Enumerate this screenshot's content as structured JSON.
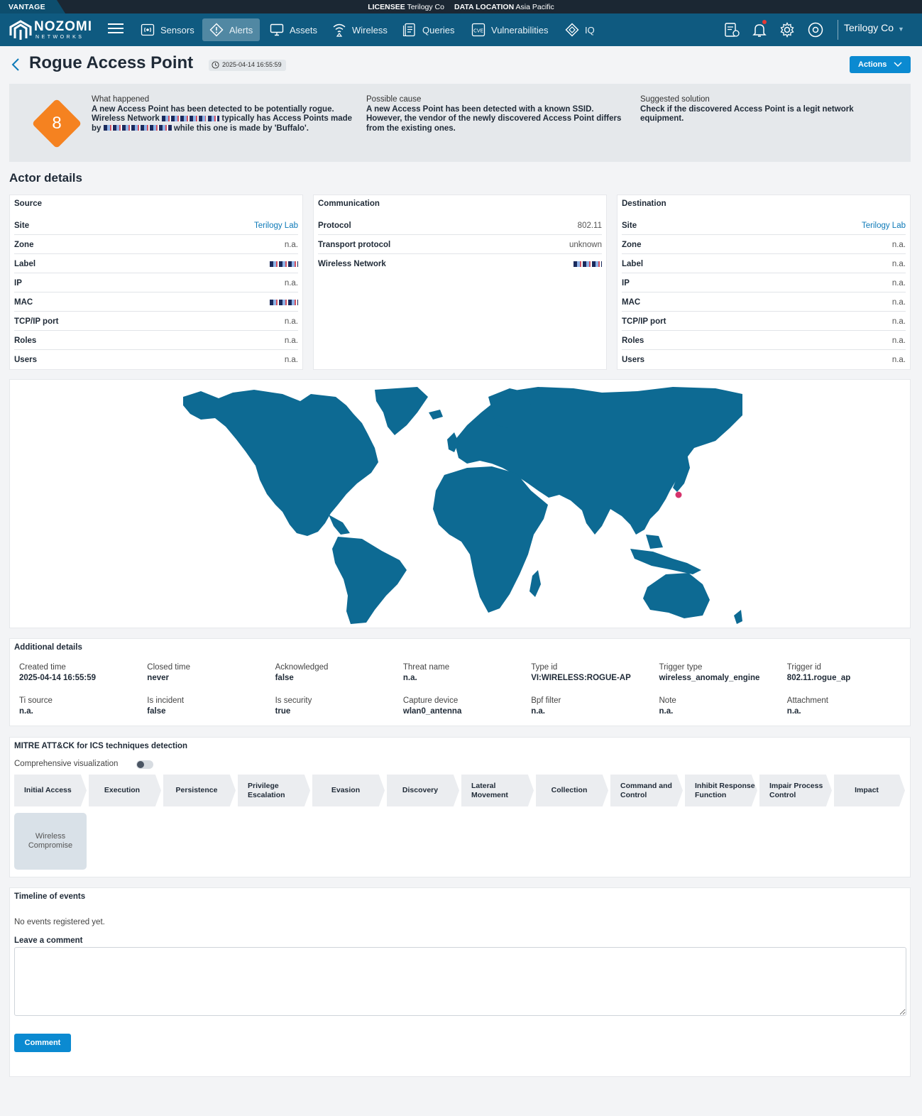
{
  "topbar": {
    "product": "VANTAGE",
    "licensee_label": "LICENSEE",
    "licensee_value": "Terilogy Co",
    "location_label": "DATA LOCATION",
    "location_value": "Asia Pacific"
  },
  "nav": {
    "logo_word": "NOZOMI",
    "logo_sub": "NETWORKS",
    "items": [
      {
        "label": "Sensors",
        "icon": "sensors-icon"
      },
      {
        "label": "Alerts",
        "icon": "alert-icon",
        "active": true
      },
      {
        "label": "Assets",
        "icon": "monitor-icon"
      },
      {
        "label": "Wireless",
        "icon": "wireless-icon"
      },
      {
        "label": "Queries",
        "icon": "queries-icon"
      },
      {
        "label": "Vulnerabilities",
        "icon": "cve-icon"
      },
      {
        "label": "IQ",
        "icon": "iq-icon"
      }
    ],
    "tenant": "Terilogy Co"
  },
  "header": {
    "title": "Rogue Access Point",
    "timestamp": "2025-04-14 16:55:59",
    "actions_label": "Actions"
  },
  "summary": {
    "risk": "8",
    "what_label": "What happened",
    "what_1": "A new Access Point has been detected to be potentially rogue. Wireless Network",
    "what_2": "typically has Access Points made by",
    "what_3": "while this one is made by 'Buffalo'.",
    "cause_label": "Possible cause",
    "cause_text": "A new Access Point has been detected with a known SSID. However, the vendor of the newly discovered Access Point differs from the existing ones.",
    "solution_label": "Suggested solution",
    "solution_text": "Check if the discovered Access Point is a legit network equipment."
  },
  "actor": {
    "title": "Actor details",
    "source": {
      "title": "Source",
      "rows": [
        {
          "k": "Site",
          "v": "Terilogy Lab"
        },
        {
          "k": "Zone",
          "v": "n.a."
        },
        {
          "k": "Label",
          "v": ""
        },
        {
          "k": "IP",
          "v": "n.a."
        },
        {
          "k": "MAC",
          "v": ""
        },
        {
          "k": "TCP/IP port",
          "v": "n.a."
        },
        {
          "k": "Roles",
          "v": "n.a."
        },
        {
          "k": "Users",
          "v": "n.a."
        }
      ]
    },
    "communication": {
      "title": "Communication",
      "rows": [
        {
          "k": "Protocol",
          "v": "802.11"
        },
        {
          "k": "Transport protocol",
          "v": "unknown"
        },
        {
          "k": "Wireless Network",
          "v": ""
        }
      ]
    },
    "destination": {
      "title": "Destination",
      "rows": [
        {
          "k": "Site",
          "v": "Terilogy Lab"
        },
        {
          "k": "Zone",
          "v": "n.a."
        },
        {
          "k": "Label",
          "v": "n.a."
        },
        {
          "k": "IP",
          "v": "n.a."
        },
        {
          "k": "MAC",
          "v": "n.a."
        },
        {
          "k": "TCP/IP port",
          "v": "n.a."
        },
        {
          "k": "Roles",
          "v": "n.a."
        },
        {
          "k": "Users",
          "v": "n.a."
        }
      ]
    }
  },
  "map": {
    "land_color": "#0d6a93",
    "marker_color": "#d6336c"
  },
  "additional": {
    "title": "Additional details",
    "fields": [
      {
        "k": "Created time",
        "v": "2025-04-14 16:55:59"
      },
      {
        "k": "Closed time",
        "v": "never"
      },
      {
        "k": "Acknowledged",
        "v": "false"
      },
      {
        "k": "Threat name",
        "v": "n.a."
      },
      {
        "k": "Type id",
        "v": "VI:WIRELESS:ROGUE-AP"
      },
      {
        "k": "Trigger type",
        "v": "wireless_anomaly_engine"
      },
      {
        "k": "Trigger id",
        "v": "802.11.rogue_ap"
      },
      {
        "k": "Ti source",
        "v": "n.a."
      },
      {
        "k": "Is incident",
        "v": "false"
      },
      {
        "k": "Is security",
        "v": "true"
      },
      {
        "k": "Capture device",
        "v": "wlan0_antenna"
      },
      {
        "k": "Bpf filter",
        "v": "n.a."
      },
      {
        "k": "Note",
        "v": "n.a."
      },
      {
        "k": "Attachment",
        "v": "n.a."
      }
    ]
  },
  "mitre": {
    "title": "MITRE ATT&CK for ICS techniques detection",
    "toggle_label": "Comprehensive visualization",
    "tactics": [
      "Initial Access",
      "Execution",
      "Persistence",
      "Privilege Escalation",
      "Evasion",
      "Discovery",
      "Lateral Movement",
      "Collection",
      "Command and Control",
      "Inhibit Response Function",
      "Impair Process Control",
      "Impact"
    ],
    "technique": "Wireless Compromise"
  },
  "timeline": {
    "title": "Timeline of events",
    "empty": "No events registered yet.",
    "comment_label": "Leave a comment",
    "comment_button": "Comment"
  }
}
